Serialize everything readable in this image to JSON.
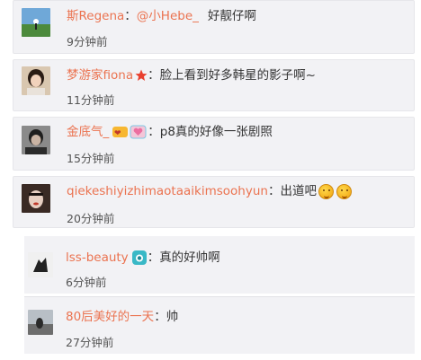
{
  "comments": [
    {
      "name": "斯Regena",
      "sep": "：",
      "mention": "@小Hebe_",
      "text": "好靓仔啊",
      "time": "9分钟前"
    },
    {
      "name": "梦游家fiona",
      "badge": "star-badge-icon",
      "sep": "：",
      "text": "脸上看到好多韩星的影子啊~",
      "time": "11分钟前"
    },
    {
      "name": "金底气_",
      "badge": "vip-emblem-icon",
      "sep": "：",
      "text": "p8真的好像一张剧照",
      "time": "15分钟前"
    },
    {
      "name": "qiekeshiyizhimaotaaikimsoohyun",
      "sep": "：",
      "text": "出道吧",
      "emoji": "laughing-emoji-icon",
      "time": "20分钟前"
    }
  ],
  "replies": [
    {
      "name": "lss-beauty",
      "badge": "camera-badge-icon",
      "sep": "：",
      "text": "真的好帅啊",
      "time": "6分钟前"
    },
    {
      "name": "80后美好的一天",
      "sep": "：",
      "text": "帅",
      "time": "27分钟前"
    }
  ],
  "colors": {
    "name": "#eb7350",
    "card_bg": "#f2f2f5",
    "text": "#333333",
    "time": "#555555"
  }
}
